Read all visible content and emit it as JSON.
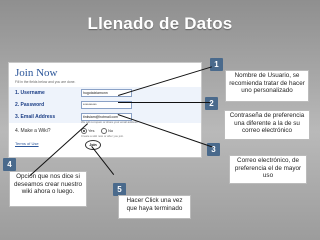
{
  "slide": {
    "title": "Llenado de Datos"
  },
  "form": {
    "header": "Join Now",
    "hint": "Fill in the fields below and you are done.",
    "fields": [
      {
        "label": "1. Username",
        "value": "hugotaixiamonn"
      },
      {
        "label": "2. Password",
        "value": "**********"
      },
      {
        "label": "3. Email Address",
        "value": "tiniisiam@hotmail.com",
        "subhint": "We will not spam or share your email address"
      }
    ],
    "wiki_question": "4. Make a Wiki?",
    "wiki_options": [
      "Yes",
      "No"
    ],
    "wiki_hint": "Create a wiki now or after you join.",
    "terms_label": "Terms of Use",
    "join_button": "Join"
  },
  "callouts": [
    {
      "num": "1",
      "text": "Nombre de Usuario, se recomienda tratar de hacer uno personalizado"
    },
    {
      "num": "2",
      "text": "Contraseña de preferencia una diferente a la de su correo electrónico"
    },
    {
      "num": "3",
      "text": "Correo electrónico, de preferencia el de mayor uso"
    },
    {
      "num": "4",
      "text": "Opción que nos dice si deseamos crear nuestro wiki ahora o luego."
    },
    {
      "num": "5",
      "text": "Hacer Click una vez que haya terminado"
    }
  ],
  "colors": {
    "accent_number_box": "#4a6a8c",
    "background": "#a6a6a6"
  }
}
